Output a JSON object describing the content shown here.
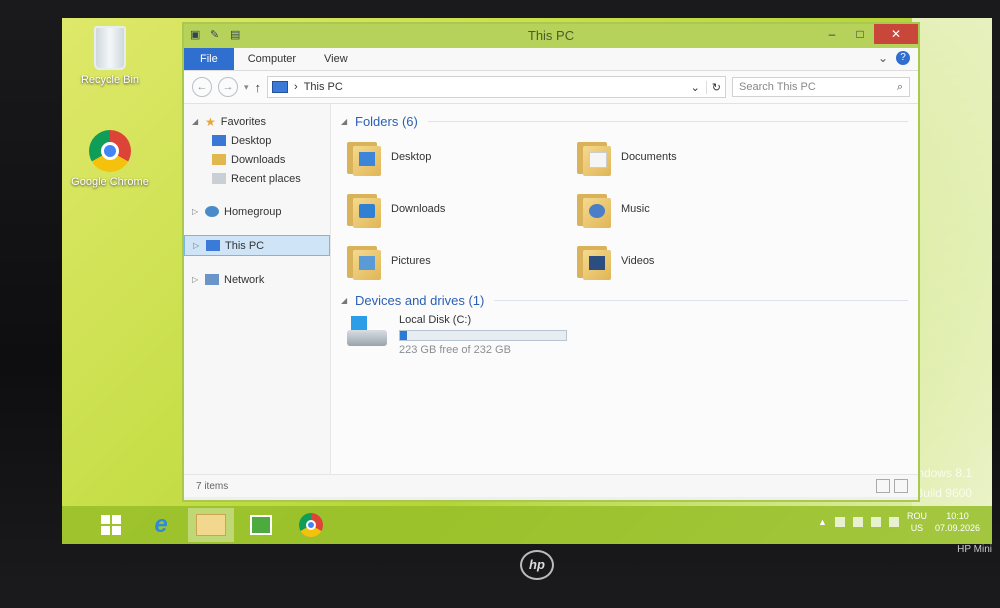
{
  "desktop": {
    "icons": [
      {
        "label": "Recycle Bin",
        "icon": "recycle-bin-icon"
      },
      {
        "label": "Google Chrome",
        "icon": "chrome-icon"
      }
    ],
    "watermark": {
      "line1": "Windows 8.1",
      "line2": "Build 9600"
    }
  },
  "window": {
    "title": "This PC",
    "controls": {
      "minimize": "–",
      "maximize": "□",
      "close": "✕"
    },
    "ribbon": {
      "file": "File",
      "tabs": [
        "Computer",
        "View"
      ],
      "help": "?",
      "expand": "⌄"
    },
    "address": {
      "back": "←",
      "forward": "→",
      "up": "↑",
      "separator": "›",
      "path": "This PC",
      "dropdown": "⌄",
      "refresh": "↻"
    },
    "search": {
      "placeholder": "Search This PC",
      "icon": "search-icon"
    },
    "nav": {
      "favorites": "Favorites",
      "favorite_items": [
        "Desktop",
        "Downloads",
        "Recent places"
      ],
      "homegroup": "Homegroup",
      "this_pc": "This PC",
      "network": "Network"
    },
    "content": {
      "folders_header": "Folders (6)",
      "folders": [
        "Desktop",
        "Documents",
        "Downloads",
        "Music",
        "Pictures",
        "Videos"
      ],
      "drives_header": "Devices and drives (1)",
      "drive": {
        "name": "Local Disk (C:)",
        "free_text": "223 GB free of 232 GB",
        "used_fraction": 0.04
      }
    },
    "status": {
      "items": "7 items"
    }
  },
  "taskbar": {
    "tray": {
      "lang_top": "ROU",
      "lang_bottom": "US",
      "time": "10:10",
      "date": "07.09.2026"
    }
  },
  "device": {
    "logo": "hp",
    "model": "HP Mini"
  },
  "colors": {
    "accent": "#2f6fcf",
    "desktop": "#c8df4a",
    "close": "#c9463b"
  }
}
